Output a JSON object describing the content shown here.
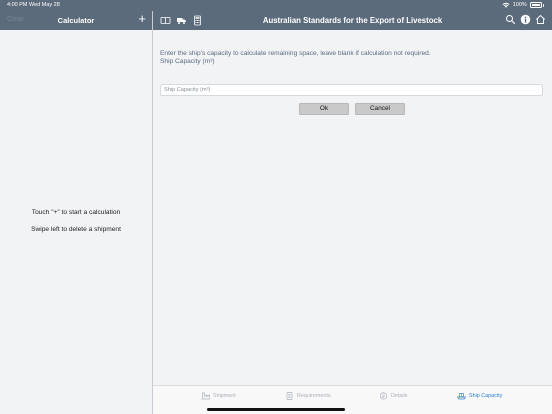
{
  "status_bar": {
    "time": "4:00 PM  Wed May 28",
    "battery": "100%"
  },
  "left_nav": {
    "clear_label": "Clear",
    "title": "Calculator",
    "add_label": "+"
  },
  "right_nav": {
    "title": "Australian Standards for the Export of Livestock",
    "left_icons": [
      "book-icon",
      "truck-icon",
      "calculator-icon"
    ],
    "right_icons": [
      "search-icon",
      "info-icon",
      "home-icon"
    ]
  },
  "left_panel": {
    "hint_1": "Touch \"+\" to start a calculation",
    "hint_2": "Swipe left to delete a shipment"
  },
  "main": {
    "description": "Enter the ship's capacity to calculate remaining space, leave blank if calculation not required.",
    "field_label": "Ship Capacity (m³)",
    "input": {
      "value": "",
      "placeholder": "Ship Capacity (m³)"
    },
    "ok_label": "Ok",
    "cancel_label": "Cancel"
  },
  "tabs": [
    {
      "label": "Shipment",
      "icon": "shipment-icon",
      "active": false
    },
    {
      "label": "Requirements",
      "icon": "requirements-icon",
      "active": false
    },
    {
      "label": "Details",
      "icon": "details-icon",
      "active": false
    },
    {
      "label": "Ship Capacity",
      "icon": "ship-capacity-icon",
      "active": true
    }
  ],
  "colors": {
    "nav_bar": "#5c6b7c",
    "accent": "#2f7fd0",
    "description_text": "#5a6b7e"
  }
}
